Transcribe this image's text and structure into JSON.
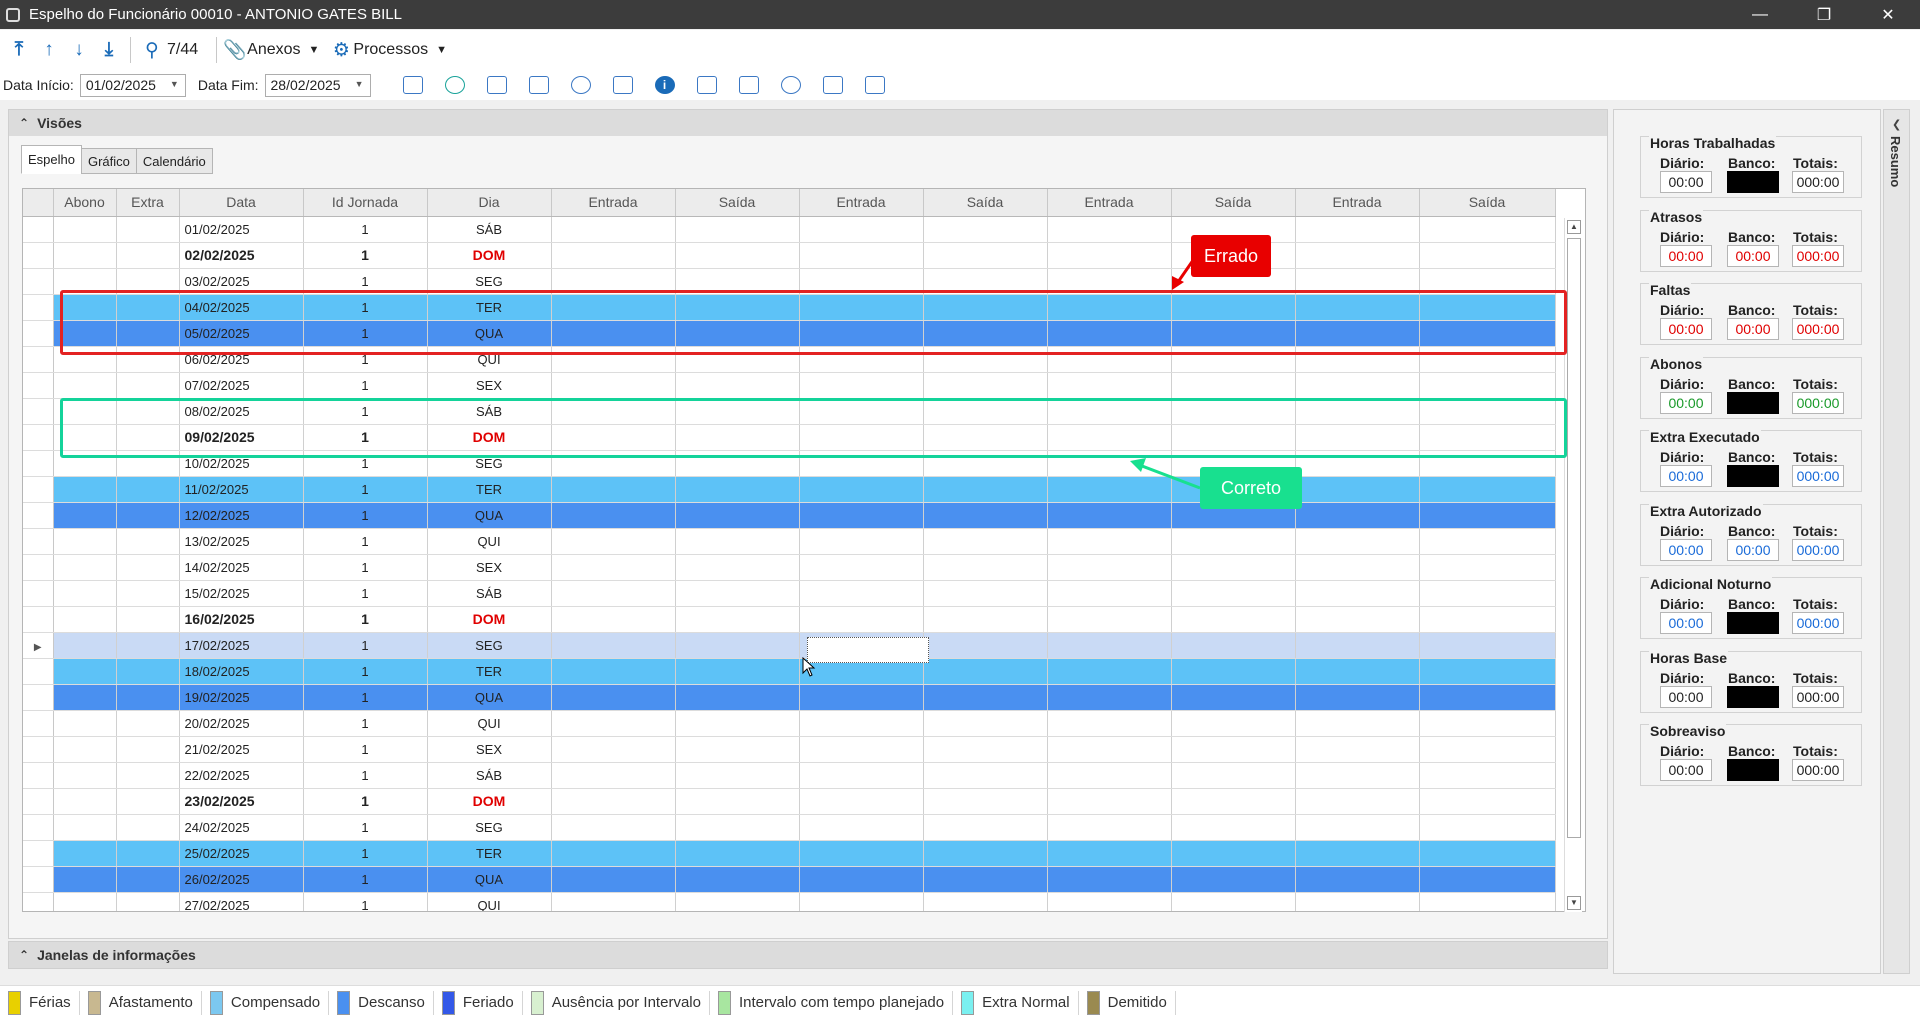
{
  "window": {
    "title": "Espelho do Funcionário 00010 - ANTONIO GATES BILL"
  },
  "toolbar": {
    "counter": "7/44",
    "anexos": "Anexos",
    "processos": "Processos"
  },
  "filters": {
    "start_label": "Data Início:",
    "start_value": "01/02/2025",
    "end_label": "Data Fim:",
    "end_value": "28/02/2025"
  },
  "visoes": {
    "title": "Visões",
    "tabs": [
      "Espelho",
      "Gráfico",
      "Calendário"
    ]
  },
  "grid": {
    "columns": [
      "Abono",
      "Extra",
      "Data",
      "Id Jornada",
      "Dia",
      "Entrada",
      "Saída",
      "Entrada",
      "Saída",
      "Entrada",
      "Saída",
      "Entrada",
      "Saída"
    ],
    "rows": [
      {
        "data": "01/02/2025",
        "jornada": "1",
        "dia": "SÁB",
        "style": "normal"
      },
      {
        "data": "02/02/2025",
        "jornada": "1",
        "dia": "DOM",
        "style": "dom"
      },
      {
        "data": "03/02/2025",
        "jornada": "1",
        "dia": "SEG",
        "style": "normal"
      },
      {
        "data": "04/02/2025",
        "jornada": "1",
        "dia": "TER",
        "style": "ter"
      },
      {
        "data": "05/02/2025",
        "jornada": "1",
        "dia": "QUA",
        "style": "qua"
      },
      {
        "data": "06/02/2025",
        "jornada": "1",
        "dia": "QUI",
        "style": "normal"
      },
      {
        "data": "07/02/2025",
        "jornada": "1",
        "dia": "SEX",
        "style": "normal"
      },
      {
        "data": "08/02/2025",
        "jornada": "1",
        "dia": "SÁB",
        "style": "normal"
      },
      {
        "data": "09/02/2025",
        "jornada": "1",
        "dia": "DOM",
        "style": "dom"
      },
      {
        "data": "10/02/2025",
        "jornada": "1",
        "dia": "SEG",
        "style": "normal"
      },
      {
        "data": "11/02/2025",
        "jornada": "1",
        "dia": "TER",
        "style": "ter"
      },
      {
        "data": "12/02/2025",
        "jornada": "1",
        "dia": "QUA",
        "style": "qua"
      },
      {
        "data": "13/02/2025",
        "jornada": "1",
        "dia": "QUI",
        "style": "normal"
      },
      {
        "data": "14/02/2025",
        "jornada": "1",
        "dia": "SEX",
        "style": "normal"
      },
      {
        "data": "15/02/2025",
        "jornada": "1",
        "dia": "SÁB",
        "style": "normal"
      },
      {
        "data": "16/02/2025",
        "jornada": "1",
        "dia": "DOM",
        "style": "dom"
      },
      {
        "data": "17/02/2025",
        "jornada": "1",
        "dia": "SEG",
        "style": "cur"
      },
      {
        "data": "18/02/2025",
        "jornada": "1",
        "dia": "TER",
        "style": "ter"
      },
      {
        "data": "19/02/2025",
        "jornada": "1",
        "dia": "QUA",
        "style": "qua"
      },
      {
        "data": "20/02/2025",
        "jornada": "1",
        "dia": "QUI",
        "style": "normal"
      },
      {
        "data": "21/02/2025",
        "jornada": "1",
        "dia": "SEX",
        "style": "normal"
      },
      {
        "data": "22/02/2025",
        "jornada": "1",
        "dia": "SÁB",
        "style": "normal"
      },
      {
        "data": "23/02/2025",
        "jornada": "1",
        "dia": "DOM",
        "style": "dom"
      },
      {
        "data": "24/02/2025",
        "jornada": "1",
        "dia": "SEG",
        "style": "normal"
      },
      {
        "data": "25/02/2025",
        "jornada": "1",
        "dia": "TER",
        "style": "ter"
      },
      {
        "data": "26/02/2025",
        "jornada": "1",
        "dia": "QUA",
        "style": "qua"
      },
      {
        "data": "27/02/2025",
        "jornada": "1",
        "dia": "QUI",
        "style": "normal"
      }
    ]
  },
  "annotations": {
    "wrong": "Errado",
    "right": "Correto"
  },
  "janelas": {
    "title": "Janelas de informações"
  },
  "legend": [
    {
      "label": "Férias",
      "color": "#e8d000"
    },
    {
      "label": "Afastamento",
      "color": "#c8b890"
    },
    {
      "label": "Compensado",
      "color": "#7cc8f0"
    },
    {
      "label": "Descanso",
      "color": "#4a90f0"
    },
    {
      "label": "Feriado",
      "color": "#3358e8"
    },
    {
      "label": "Ausência por Intervalo",
      "color": "#d8f0d0"
    },
    {
      "label": "Intervalo com tempo planejado",
      "color": "#a8e6a0"
    },
    {
      "label": "Extra Normal",
      "color": "#7af0f0"
    },
    {
      "label": "Demitido",
      "color": "#9a8a50"
    }
  ],
  "resumo": {
    "title": "Resumo",
    "sub_labels": {
      "diario": "Diário:",
      "banco": "Banco:",
      "totais": "Totais:"
    },
    "groups": [
      {
        "title": "Horas Trabalhadas",
        "diario": "00:00",
        "banco": "",
        "totais": "000:00",
        "tone": "dark",
        "banco_black": true
      },
      {
        "title": "Atrasos",
        "diario": "00:00",
        "banco": "00:00",
        "totais": "000:00",
        "tone": "red",
        "banco_black": false
      },
      {
        "title": "Faltas",
        "diario": "00:00",
        "banco": "00:00",
        "totais": "000:00",
        "tone": "red",
        "banco_black": false
      },
      {
        "title": "Abonos",
        "diario": "00:00",
        "banco": "",
        "totais": "000:00",
        "tone": "green",
        "banco_black": true
      },
      {
        "title": "Extra Executado",
        "diario": "00:00",
        "banco": "",
        "totais": "000:00",
        "tone": "blue",
        "banco_black": true
      },
      {
        "title": "Extra Autorizado",
        "diario": "00:00",
        "banco": "00:00",
        "totais": "000:00",
        "tone": "blue",
        "banco_black": false
      },
      {
        "title": "Adicional Noturno",
        "diario": "00:00",
        "banco": "",
        "totais": "000:00",
        "tone": "blue",
        "banco_black": true
      },
      {
        "title": "Horas Base",
        "diario": "00:00",
        "banco": "",
        "totais": "000:00",
        "tone": "dark",
        "banco_black": true
      },
      {
        "title": "Sobreaviso",
        "diario": "00:00",
        "banco": "",
        "totais": "000:00",
        "tone": "dark",
        "banco_black": true
      }
    ]
  }
}
